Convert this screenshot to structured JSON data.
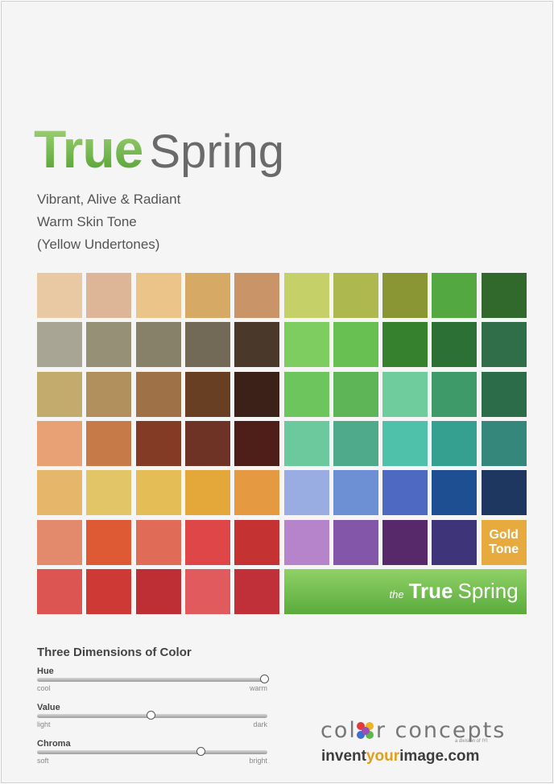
{
  "title": {
    "part1": "True",
    "part2": "Spring"
  },
  "description": [
    "Vibrant, Alive & Radiant",
    "Warm Skin Tone",
    "(Yellow Undertones)"
  ],
  "palette": {
    "left": [
      [
        "#e8c9a3",
        "#dcb696",
        "#ebc489",
        "#d6aa64",
        "#c99467"
      ],
      [
        "#a9a595",
        "#969077",
        "#87816a",
        "#736957",
        "#4a382b"
      ],
      [
        "#c2ab6c",
        "#b2905e",
        "#9f7146",
        "#683f23",
        "#3b2117"
      ],
      [
        "#e8a075",
        "#c67a48",
        "#843b25",
        "#6e3325",
        "#4d1f18"
      ],
      [
        "#e6b66a",
        "#e2c567",
        "#e5bd57",
        "#e4a73a",
        "#e59a42"
      ],
      [
        "#e28a6b",
        "#de5a34",
        "#e06b57",
        "#de4647",
        "#c53232"
      ],
      [
        "#dc5552",
        "#cf3935",
        "#be2f35",
        "#e15a5e",
        "#c03038"
      ]
    ],
    "right": [
      [
        "#c6d068",
        "#adb94f",
        "#8a9534",
        "#53a841",
        "#31682b"
      ],
      [
        "#7dcd61",
        "#68c053",
        "#36812d",
        "#2c7035",
        "#2f6e48"
      ],
      [
        "#6cc55d",
        "#5db557",
        "#6fcc9c",
        "#3e9a68",
        "#2d6c48"
      ],
      [
        "#6cc99e",
        "#4fa98b",
        "#4fc0aa",
        "#35a090",
        "#35877b"
      ],
      [
        "#9aade3",
        "#6d8fd4",
        "#4d69c2",
        "#1e4f93",
        "#1d3761"
      ],
      [
        "#b584cb",
        "#8356a9",
        "#57296b",
        "#3d3479"
      ]
    ],
    "gold_tone": {
      "line1": "Gold",
      "line2": "Tone",
      "color": "#e7aa3e"
    },
    "banner": {
      "the": "the",
      "true": "True",
      "spring": "Spring"
    }
  },
  "dimensions": {
    "title": "Three Dimensions of Color",
    "sliders": [
      {
        "name": "Hue",
        "low": "cool",
        "high": "warm",
        "level": 1.0
      },
      {
        "name": "Value",
        "low": "light",
        "high": "dark",
        "level": 0.5
      },
      {
        "name": "Chroma",
        "low": "soft",
        "high": "bright",
        "level": 0.72
      }
    ]
  },
  "brand": {
    "logo_prefix": "col",
    "logo_suffix": "r concepts",
    "tagline": "a division of IYI",
    "site": {
      "a": "invent",
      "b": "your",
      "c": "image.com"
    }
  }
}
